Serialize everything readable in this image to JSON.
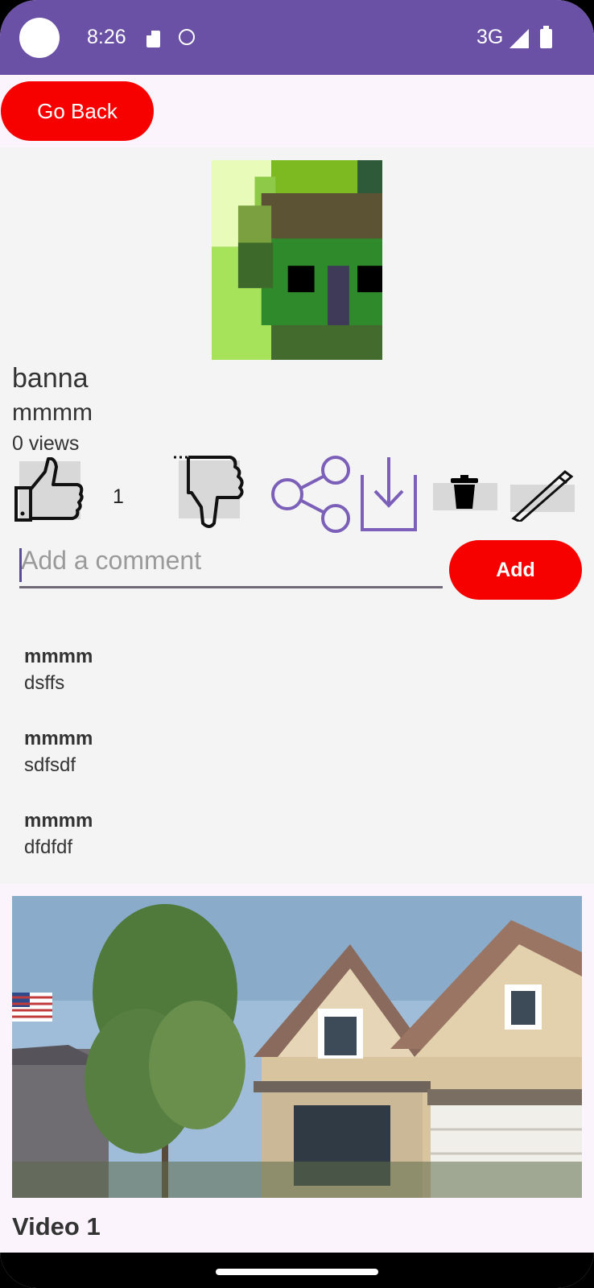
{
  "status_bar": {
    "time": "8:26",
    "network": "3G",
    "icons": [
      "sd-card-icon",
      "ghost-icon",
      "signal-icon",
      "battery-icon"
    ]
  },
  "top": {
    "back_label": "Go Back"
  },
  "video": {
    "title": "banna",
    "author": "mmmm",
    "views": "0 views",
    "like_count": "1"
  },
  "actions": [
    "thumbs-up-icon",
    "thumbs-down-icon",
    "share-icon",
    "download-icon",
    "delete-icon",
    "edit-icon"
  ],
  "comment_box": {
    "placeholder": "Add a comment",
    "add_label": "Add"
  },
  "comments": [
    {
      "author": "mmmm",
      "text": "dsffs"
    },
    {
      "author": "mmmm",
      "text": "sdfsdf"
    },
    {
      "author": "mmmm",
      "text": "dfdfdf"
    }
  ],
  "related": [
    {
      "title": "Video 1"
    }
  ],
  "colors": {
    "accent": "#6a51a5",
    "button": "#f60000",
    "background": "#f4f4f4"
  }
}
